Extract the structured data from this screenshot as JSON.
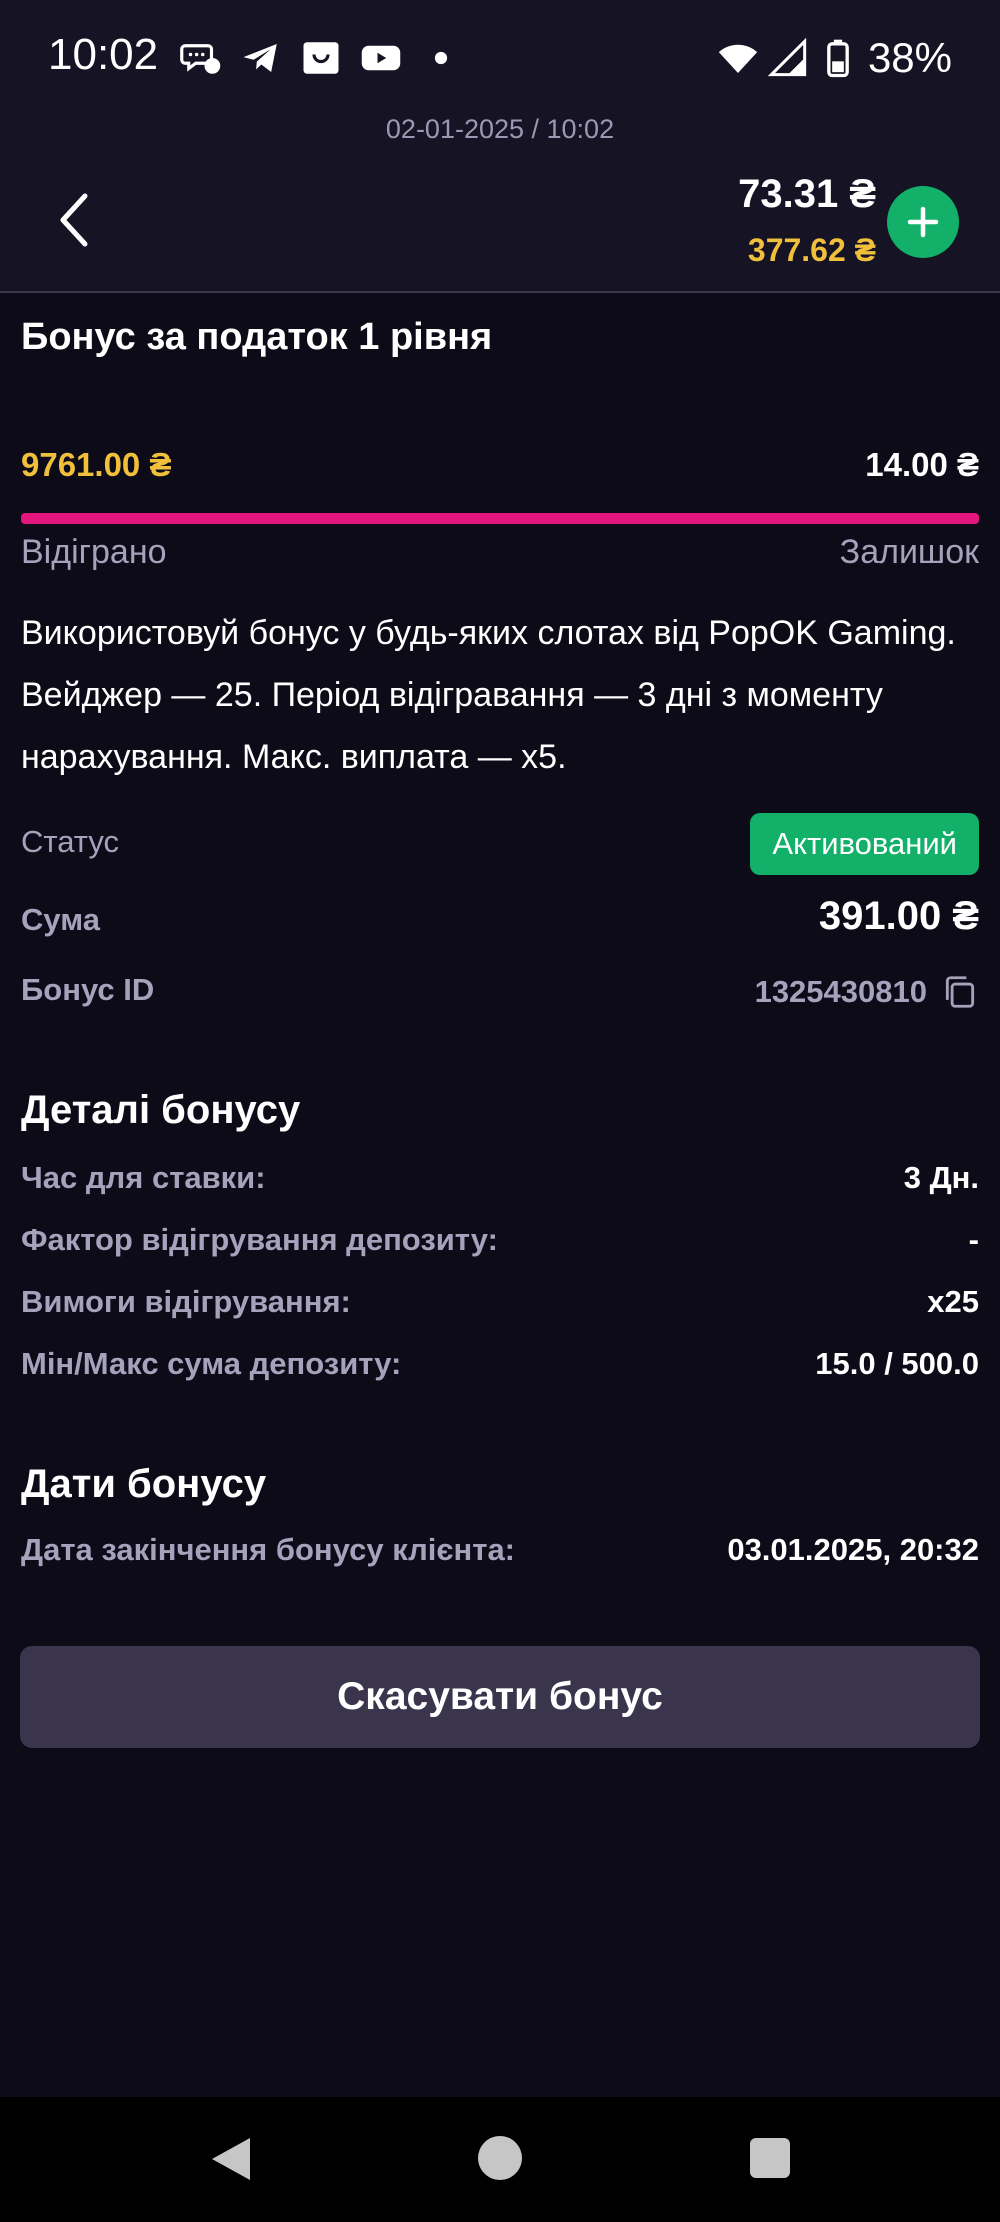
{
  "status_bar": {
    "time": "10:02",
    "battery": "38%",
    "notification_icons": [
      "chat-bubble-icon",
      "telegram-icon",
      "shopping-bag-icon",
      "youtube-icon",
      "dot-icon"
    ],
    "system_icons": [
      "wifi-icon",
      "signal-icon",
      "battery-icon"
    ]
  },
  "header": {
    "datetime": "02-01-2025 / 10:02",
    "balance_main": "73.31 ₴",
    "balance_bonus": "377.62 ₴",
    "add_icon": "plus-icon",
    "back_icon": "chevron-left-icon"
  },
  "bonus": {
    "title": "Бонус за податок 1 рівня",
    "wagered_amount": "9761.00 ₴",
    "remaining_amount": "14.00 ₴",
    "wagered_label": "Відіграно",
    "remaining_label": "Залишок",
    "progress_fraction": 1.0,
    "description": "Використовуй бонус у будь-яких слотах від PopOK Gaming. Вейджер — 25. Період відігравання — 3 дні з моменту нарахування. Макс. виплата — x5.",
    "status_label": "Статус",
    "status_value": "Активований",
    "sum_label": "Сума",
    "sum_value": "391.00 ₴",
    "id_label": "Бонус ID",
    "id_value": "1325430810"
  },
  "details": {
    "title": "Деталі бонусу",
    "rows": [
      {
        "label": "Час для ставки:",
        "value": "3 Дн."
      },
      {
        "label": "Фактор відігрування депозиту:",
        "value": "-"
      },
      {
        "label": "Вимоги відігрування:",
        "value": "x25"
      },
      {
        "label": "Мін/Макс сума депозиту:",
        "value": "15.0 / 500.0"
      }
    ]
  },
  "dates": {
    "title": "Дати бонусу",
    "rows": [
      {
        "label": "Дата закінчення бонусу клієнта:",
        "value": "03.01.2025, 20:32"
      }
    ]
  },
  "actions": {
    "cancel_label": "Скасувати бонус"
  },
  "colors": {
    "background": "#0d0b18",
    "header_bg": "#151324",
    "accent_gold": "#f0bf3c",
    "progress_pink": "#e3167e",
    "success_green": "#12b068",
    "muted_text": "#a6a2bc",
    "button_bg": "#3a354c"
  }
}
